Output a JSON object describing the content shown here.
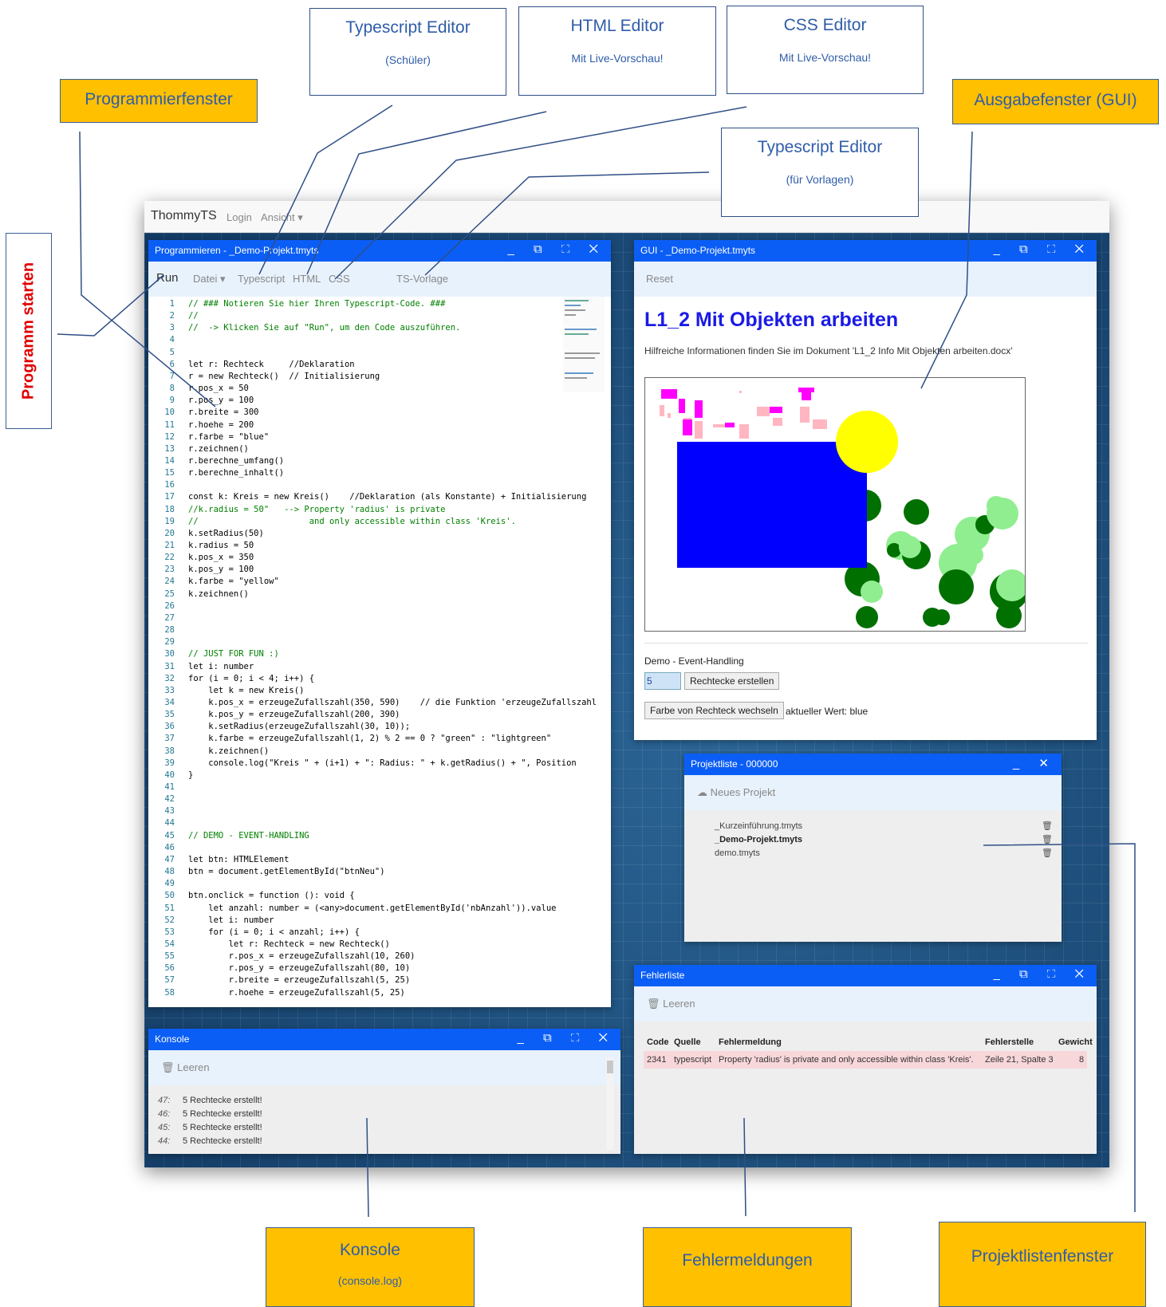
{
  "callouts": {
    "ts_editor": {
      "title": "Typescript Editor",
      "sub": "(Schüler)"
    },
    "html_editor": {
      "title": "HTML Editor",
      "sub": "Mit Live-Vorschau!"
    },
    "css_editor": {
      "title": "CSS Editor",
      "sub": "Mit Live-Vorschau!"
    },
    "programmierfenster": "Programmierfenster",
    "ausgabefenster": "Ausgabefenster (GUI)",
    "ts_vorlage": {
      "title": "Typescript Editor",
      "sub": "(für Vorlagen)"
    },
    "programm_starten": "Programm starten",
    "konsole": {
      "title": "Konsole",
      "sub": "(console.log)"
    },
    "fehlermeldungen": "Fehlermeldungen",
    "projektliste": "Projektlistenfenster"
  },
  "app": {
    "brand": "ThommyTS",
    "nav_login": "Login",
    "nav_ansicht": "Ansicht ▾"
  },
  "editor": {
    "title": "Programmieren - _Demo-Projekt.tmyts",
    "controls": "_ ⧉ ⛶ ✕",
    "tb_run": "Run",
    "tb_datei": "Datei ▾",
    "tb_typescript": "Typescript",
    "tb_html": "HTML",
    "tb_css": "CSS",
    "tb_tsvorlage": "TS-Vorlage",
    "lines": [
      "// ### Notieren Sie hier Ihren Typescript-Code. ###",
      "//",
      "//  -> Klicken Sie auf \"Run\", um den Code auszuführen.",
      "",
      "",
      "let r: Rechteck     //Deklaration",
      "r = new Rechteck()  // Initialisierung",
      "r.pos_x = 50",
      "r.pos_y = 100",
      "r.breite = 300",
      "r.hoehe = 200",
      "r.farbe = \"blue\"",
      "r.zeichnen()",
      "r.berechne_umfang()",
      "r.berechne_inhalt()",
      "",
      "const k: Kreis = new Kreis()    //Deklaration (als Konstante) + Initialisierung",
      "//k.radius = 50\"   --> Property 'radius' is private",
      "//                      and only accessible within class 'Kreis'.",
      "k.setRadius(50)",
      "k.radius = 50",
      "k.pos_x = 350",
      "k.pos_y = 100",
      "k.farbe = \"yellow\"",
      "k.zeichnen()",
      "",
      "",
      "",
      "",
      "// JUST FOR FUN :)",
      "let i: number",
      "for (i = 0; i < 4; i++) {",
      "    let k = new Kreis()",
      "    k.pos_x = erzeugeZufallszahl(350, 590)    // die Funktion 'erzeugeZufallszahl",
      "    k.pos_y = erzeugeZufallszahl(200, 390)",
      "    k.setRadius(erzeugeZufallszahl(30, 10));",
      "    k.farbe = erzeugeZufallszahl(1, 2) % 2 == 0 ? \"green\" : \"lightgreen\"",
      "    k.zeichnen()",
      "    console.log(\"Kreis \" + (i+1) + \": Radius: \" + k.getRadius() + \", Position",
      "}",
      "",
      "",
      "",
      "",
      "// DEMO - EVENT-HANDLING",
      "",
      "let btn: HTMLElement",
      "btn = document.getElementById(\"btnNeu\")",
      "",
      "btn.onclick = function (): void {",
      "    let anzahl: number = (<any>document.getElementById('nbAnzahl')).value",
      "    let i: number",
      "    for (i = 0; i < anzahl; i++) {",
      "        let r: Rechteck = new Rechteck()",
      "        r.pos_x = erzeugeZufallszahl(10, 260)",
      "        r.pos_y = erzeugeZufallszahl(80, 10)",
      "        r.breite = erzeugeZufallszahl(5, 25)",
      "        r.hoehe = erzeugeZufallszahl(5, 25)"
    ]
  },
  "gui": {
    "title": "GUI - _Demo-Projekt.tmyts",
    "controls": "_ ⧉ ⛶ ✕",
    "tb_reset": "Reset",
    "heading": "L1_2 Mit Objekten arbeiten",
    "info": "Hilfreiche Informationen finden Sie im Dokument 'L1_2 Info Mit Objekten arbeiten.docx'",
    "demo_label": "Demo - Event-Handling",
    "input_value": "5",
    "btn_rechtecke": "Rechtecke erstellen",
    "btn_farbe": "Farbe von Rechteck wechseln",
    "wert_label": "aktueller Wert: blue"
  },
  "projects": {
    "title": "Projektliste - 000000",
    "controls": "_ ✕",
    "new_label": "☁ Neues Projekt",
    "items": [
      "_Kurzeinführung.tmyts",
      "_Demo-Projekt.tmyts",
      "demo.tmyts"
    ]
  },
  "console": {
    "title": "Konsole",
    "controls": "_ ⧉ ⛶ ✕",
    "clear_label": "🗑 Leeren",
    "rows": [
      {
        "n": "47:",
        "msg": "5 Rechtecke erstellt!"
      },
      {
        "n": "46:",
        "msg": "5 Rechtecke erstellt!"
      },
      {
        "n": "45:",
        "msg": "5 Rechtecke erstellt!"
      },
      {
        "n": "44:",
        "msg": "5 Rechtecke erstellt!"
      }
    ]
  },
  "errors": {
    "title": "Fehlerliste",
    "controls": "_ ⧉ ⛶ ✕",
    "clear_label": "🗑 Leeren",
    "headers": {
      "code": "Code",
      "quelle": "Quelle",
      "meldung": "Fehlermeldung",
      "stelle": "Fehlerstelle",
      "gewicht": "Gewicht"
    },
    "row": {
      "code": "2341",
      "quelle": "typescript",
      "meldung": "Property 'radius' is private and only accessible within class 'Kreis'.",
      "stelle": "Zeile 21, Spalte 3",
      "gewicht": "8"
    }
  },
  "colors": {
    "titlebar": "#0b5ef5",
    "toolbar": "#e8f2fc",
    "callout_yellow": "#ffc000",
    "heading": "#1a1ae6",
    "error_row": "#f8d7da"
  }
}
